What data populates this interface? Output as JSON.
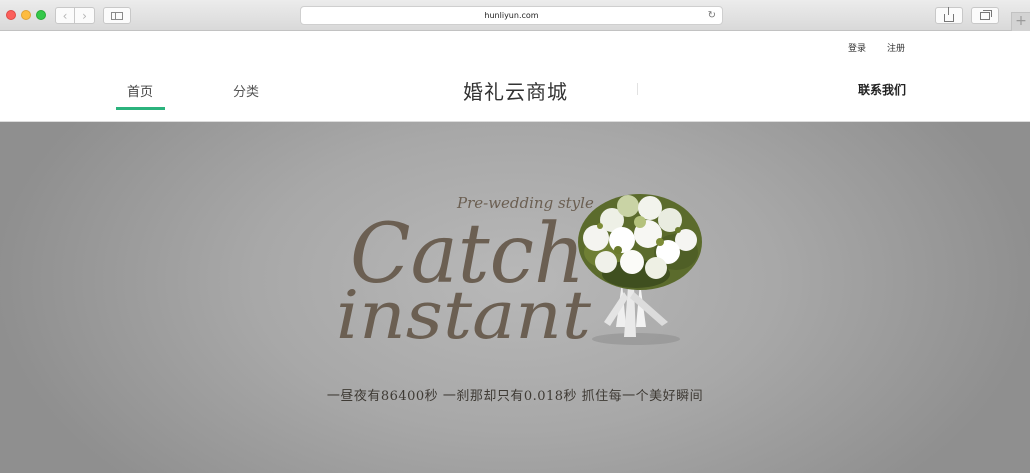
{
  "browser": {
    "url": "hunliyun.com",
    "back_icon": "chevron-left-icon",
    "forward_icon": "chevron-right-icon",
    "reload_icon": "reload-icon"
  },
  "header": {
    "login_label": "登录",
    "register_label": "注册",
    "nav": {
      "home_label": "首页",
      "category_label": "分类",
      "active_tab": "首页",
      "accent_color": "#2bb37d"
    },
    "site_title": "婚礼云商城",
    "contact_label": "联系我们"
  },
  "hero": {
    "headline_small": "Pre-wedding style",
    "headline_word1": "Catch",
    "headline_word2": "instant",
    "tagline": "一昼夜有86400秒 一刹那却只有0.018秒 抓住每一个美好瞬间",
    "image": "bridal-bouquet-image",
    "text_color": "#6b5f52"
  }
}
